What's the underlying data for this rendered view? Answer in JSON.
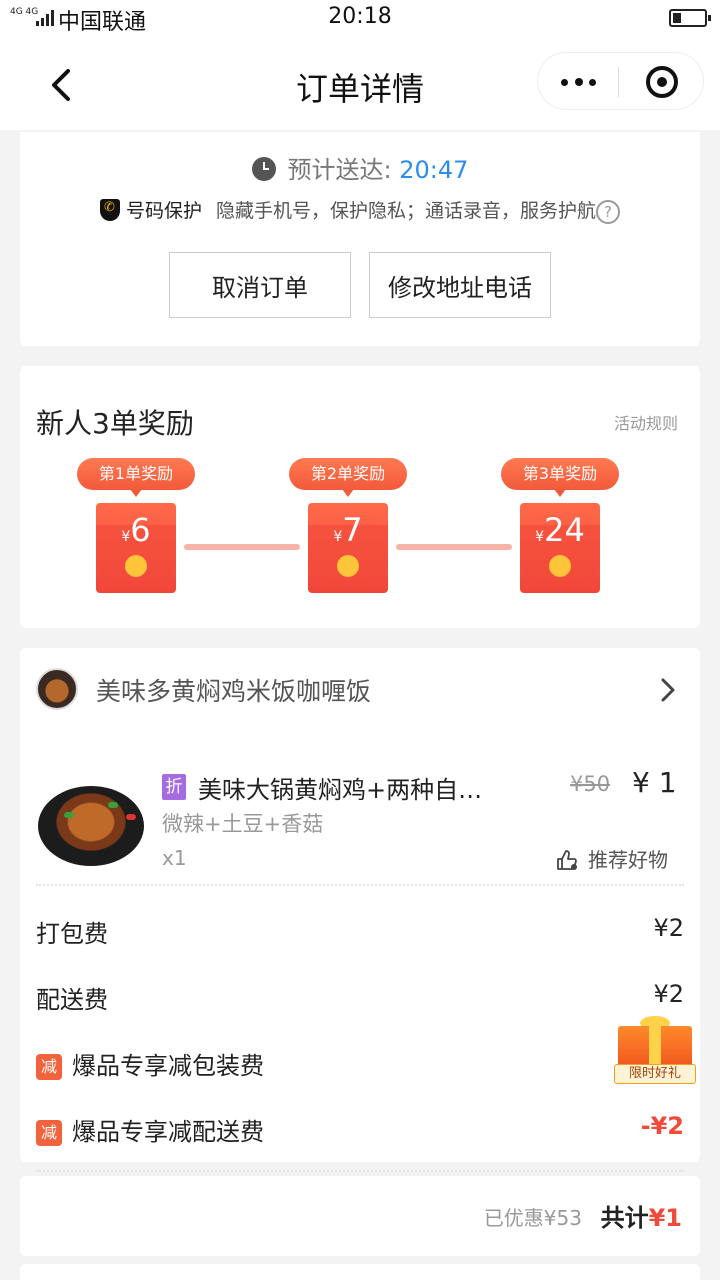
{
  "status_bar": {
    "network": "4G 4G",
    "carrier": "中国联通",
    "time": "20:18"
  },
  "nav": {
    "title": "订单详情"
  },
  "delivery": {
    "eta_label": "预计送达: ",
    "eta_time": "20:47",
    "privacy_title": "号码保护",
    "privacy_text": "隐藏手机号，保护隐私；通话录音，服务护航",
    "help_icon": "?",
    "cancel_label": "取消订单",
    "modify_label": "修改地址电话"
  },
  "rewards": {
    "title": "新人3单奖励",
    "rules_link": "活动规则",
    "items": [
      {
        "tag": "第1单奖励",
        "currency": "¥",
        "amount": "6"
      },
      {
        "tag": "第2单奖励",
        "currency": "¥",
        "amount": "7"
      },
      {
        "tag": "第3单奖励",
        "currency": "¥",
        "amount": "24"
      }
    ]
  },
  "order": {
    "shop_name": "美味多黄焖鸡米饭咖喱饭",
    "item": {
      "discount_tag": "折",
      "name": "美味大锅黄焖鸡+两种自…",
      "spec": "微辣+土豆+香菇",
      "qty": "x1",
      "original_price": "¥50",
      "price": "¥ 1",
      "recommend_label": "推荐好物"
    },
    "fees": [
      {
        "label": "打包费",
        "value": "¥2"
      },
      {
        "label": "配送费",
        "value": "¥2"
      }
    ],
    "discounts": [
      {
        "badge": "减",
        "label": "爆品专享减包装费",
        "value": ""
      },
      {
        "badge": "减",
        "label": "爆品专享减配送费",
        "value": "-¥2"
      }
    ],
    "gift_label": "限时好礼"
  },
  "summary": {
    "saved": "已优惠¥53",
    "total_label": "共计",
    "total_amount": "¥1"
  },
  "colors": {
    "accent_blue": "#2c8ee8",
    "price_red": "#f04a3a",
    "reward_orange": "#f25a3a",
    "discount_purple": "#a66be0"
  }
}
